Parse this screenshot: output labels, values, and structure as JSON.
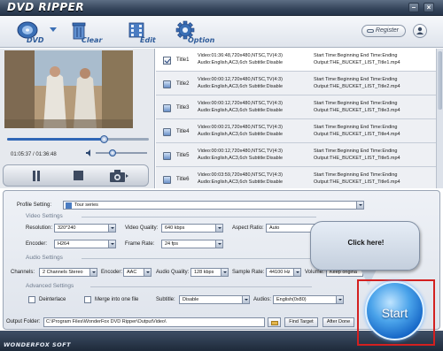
{
  "app": {
    "title": "DVD RIPPER",
    "brand": "WONDERFOX SOFT"
  },
  "window_controls": {
    "minimize": "–",
    "close": "×"
  },
  "toolbar": {
    "dvd_label": "DVD",
    "clear_label": "Clear",
    "edit_label": "Edit",
    "option_label": "Option",
    "register_label": "Register"
  },
  "player": {
    "time": "01:05:37 / 01:36:48",
    "seek_fraction": 0.68,
    "volume_fraction": 0.32
  },
  "titles": [
    {
      "name": "Title1",
      "checked": true,
      "info1": "Video:01:36:48,720x480,NTSC,TV(4:3)",
      "info2": "Audio:English,AC3,6ch Subtitle:Disable",
      "time1": "Start Time:Beginning End Time:Ending",
      "time2": "Output:THE_BUCKET_LIST_Title1.mp4"
    },
    {
      "name": "Title2",
      "checked": false,
      "info1": "Video:00:00:12,720x480,NTSC,TV(4:3)",
      "info2": "Audio:English,AC3,6ch Subtitle:Disable",
      "time1": "Start Time:Beginning End Time:Ending",
      "time2": "Output:THE_BUCKET_LIST_Title2.mp4"
    },
    {
      "name": "Title3",
      "checked": false,
      "info1": "Video:00:00:12,720x480,NTSC,TV(4:3)",
      "info2": "Audio:English,AC3,6ch Subtitle:Disable",
      "time1": "Start Time:Beginning End Time:Ending",
      "time2": "Output:THE_BUCKET_LIST_Title3.mp4"
    },
    {
      "name": "Title4",
      "checked": false,
      "info1": "Video:00:00:21,720x480,NTSC,TV(4:3)",
      "info2": "Audio:English,AC3,6ch Subtitle:Disable",
      "time1": "Start Time:Beginning End Time:Ending",
      "time2": "Output:THE_BUCKET_LIST_Title4.mp4"
    },
    {
      "name": "Title5",
      "checked": false,
      "info1": "Video:00:00:12,720x480,NTSC,TV(4:3)",
      "info2": "Audio:English,AC3,6ch Subtitle:Disable",
      "time1": "Start Time:Beginning End Time:Ending",
      "time2": "Output:THE_BUCKET_LIST_Title5.mp4"
    },
    {
      "name": "Title6",
      "checked": false,
      "info1": "Video:00:03:59,720x480,NTSC,TV(4:3)",
      "info2": "Audio:English,AC3,6ch Subtitle:Disable",
      "time1": "Start Time:Beginning End Time:Ending",
      "time2": "Output:THE_BUCKET_LIST_Title6.mp4"
    }
  ],
  "settings": {
    "profile_label": "Profile Setting:",
    "profile_value": "Tour series",
    "video_section": "Video Settings",
    "resolution_label": "Resolution:",
    "resolution_value": "320*240",
    "video_quality_label": "Video Quality:",
    "video_quality_value": "640 kbps",
    "aspect_label": "Aspect Ratio:",
    "aspect_value": "Auto",
    "encoder_label": "Encoder:",
    "encoder_value": "H264",
    "frame_rate_label": "Frame Rate:",
    "frame_rate_value": "24 fps",
    "audio_section": "Audio Settings",
    "channels_label": "Channels:",
    "channels_value": "2 Channels Stereo",
    "audio_encoder_label": "Encoder:",
    "audio_encoder_value": "AAC",
    "audio_quality_label": "Audio Quality:",
    "audio_quality_value": "128 kbps",
    "sample_rate_label": "Sample Rate:",
    "sample_rate_value": "44100 Hz",
    "volume_label": "Volume:",
    "volume_value": "Keep origina",
    "advanced_section": "Advanced Settings",
    "deinterlace_label": "Deinterlace",
    "merge_label": "Merge into one file",
    "subtitle_label": "Subtitle:",
    "subtitle_value": "Disable",
    "audios_label": "Audios:",
    "audios_value": "English(0x80)"
  },
  "output": {
    "folder_label": "Output Folder:",
    "folder_value": "C:\\Program Files\\WonderFox DVD Ripper\\OutputVideo\\",
    "find_target": "Find Target",
    "after_done": "After Done"
  },
  "callout": {
    "text": "Click here!"
  },
  "start": {
    "label": "Start"
  },
  "colors": {
    "accent": "#2f5c9a",
    "start_button": "#1566c6",
    "highlight": "#d32020"
  }
}
